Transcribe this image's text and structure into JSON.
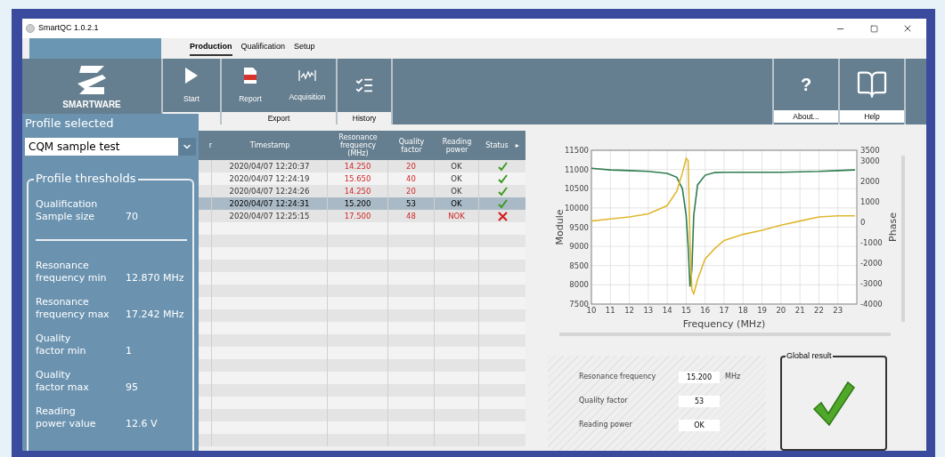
{
  "window": {
    "title": "SmartQC 1.0.2.1"
  },
  "tabs": [
    {
      "label": "Production",
      "selected": true
    },
    {
      "label": "Qualification",
      "selected": false
    },
    {
      "label": "Setup",
      "selected": false
    }
  ],
  "ribbon": {
    "logo": "SMARTWARE",
    "groups": [
      {
        "buttons": [
          {
            "kind": "start",
            "label": "Start"
          }
        ]
      },
      {
        "label": "Export",
        "buttons": [
          {
            "kind": "report",
            "label": "Report"
          },
          {
            "kind": "acquisition",
            "label": "Acquisition"
          }
        ]
      },
      {
        "label": "History",
        "buttons": [
          {
            "kind": "history"
          }
        ]
      }
    ],
    "right_buttons": [
      {
        "kind": "about",
        "glyph": "?",
        "caption": "About..."
      },
      {
        "kind": "help",
        "caption": "Help"
      }
    ]
  },
  "sidebar": {
    "title": "Profile selected",
    "profile": "CQM sample test",
    "thresholds_title": "Profile thresholds",
    "qualification": {
      "label": "Qualification\nSample size",
      "value": "70"
    },
    "items": [
      {
        "label": "Resonance\nfrequency min",
        "value": "12.870 MHz"
      },
      {
        "label": "Resonance\nfrequency max",
        "value": "17.242 MHz"
      },
      {
        "label": "Quality\nfactor min",
        "value": "1"
      },
      {
        "label": "Quality\nfactor max",
        "value": "95"
      },
      {
        "label": "Reading\npower value",
        "value": "12.6 V"
      }
    ]
  },
  "table": {
    "columns": [
      "r",
      "Timestamp",
      "Resonance frequency (MHz)",
      "Quality factor",
      "Reading power",
      "Status"
    ],
    "header_arrow": "▸",
    "rows": [
      {
        "timestamp": "2020/04/07 12:20:37",
        "frequency": "14.250",
        "quality": "20",
        "power": "OK",
        "frequency_flagged": true,
        "quality_flagged": true,
        "power_flagged": false,
        "passed": true,
        "selected": false
      },
      {
        "timestamp": "2020/04/07 12:24:19",
        "frequency": "15.650",
        "quality": "40",
        "power": "OK",
        "frequency_flagged": true,
        "quality_flagged": true,
        "power_flagged": false,
        "passed": true,
        "selected": false
      },
      {
        "timestamp": "2020/04/07 12:24:26",
        "frequency": "14.250",
        "quality": "20",
        "power": "OK",
        "frequency_flagged": true,
        "quality_flagged": true,
        "power_flagged": false,
        "passed": true,
        "selected": false
      },
      {
        "timestamp": "2020/04/07 12:24:31",
        "frequency": "15.200",
        "quality": "53",
        "power": "OK",
        "frequency_flagged": false,
        "quality_flagged": false,
        "power_flagged": false,
        "passed": true,
        "selected": true
      },
      {
        "timestamp": "2020/04/07 12:25:15",
        "frequency": "17.500",
        "quality": "48",
        "power": "NOK",
        "frequency_flagged": true,
        "quality_flagged": true,
        "power_flagged": true,
        "passed": false,
        "selected": false
      }
    ]
  },
  "chart": {
    "chart_data": {
      "type": "line",
      "xlabel": "Frequency (MHz)",
      "ylabel": "Module",
      "y2label": "Phase",
      "grid": true,
      "x": [
        10,
        11,
        12,
        13,
        14,
        14.5,
        14.8,
        15,
        15.1,
        15.2,
        15.3,
        15.4,
        15.6,
        16,
        16.5,
        17,
        18,
        19,
        20,
        21,
        22,
        23,
        23.9
      ],
      "xlim": [
        10,
        24
      ],
      "xticks": [
        10,
        11,
        12,
        13,
        14,
        15,
        16,
        17,
        18,
        19,
        20,
        21,
        22,
        23
      ],
      "ylim": [
        7500,
        11500
      ],
      "yticks": [
        7500,
        8000,
        8500,
        9000,
        9500,
        10000,
        10500,
        11000,
        11500
      ],
      "y2lim": [
        -4000,
        3500
      ],
      "y2ticks": [
        -4000,
        -3000,
        -2000,
        -1000,
        0,
        1000,
        2000,
        3000,
        3500
      ],
      "series": [
        {
          "color": "#2e7d4f",
          "values": [
            11030,
            10990,
            10970,
            10950,
            10900,
            10800,
            10500,
            9800,
            9000,
            7950,
            8400,
            9800,
            10600,
            10850,
            10920,
            10930,
            10930,
            10930,
            10930,
            10940,
            10950,
            10970,
            10990
          ]
        },
        {
          "color": "#e0b830",
          "axis": "y2",
          "values": [
            50,
            150,
            250,
            400,
            800,
            1500,
            2400,
            3100,
            3000,
            -1000,
            -3300,
            -3500,
            -2800,
            -1800,
            -1300,
            -900,
            -600,
            -400,
            -150,
            50,
            250,
            300,
            300
          ]
        }
      ]
    }
  },
  "measurements": [
    {
      "label": "Resonance frequency",
      "value": "15.200",
      "unit": "MHz"
    },
    {
      "label": "Quality factor",
      "value": "53"
    },
    {
      "label": "Reading power",
      "value": "OK"
    }
  ],
  "global_result": {
    "label": "Global result",
    "passed": true
  }
}
